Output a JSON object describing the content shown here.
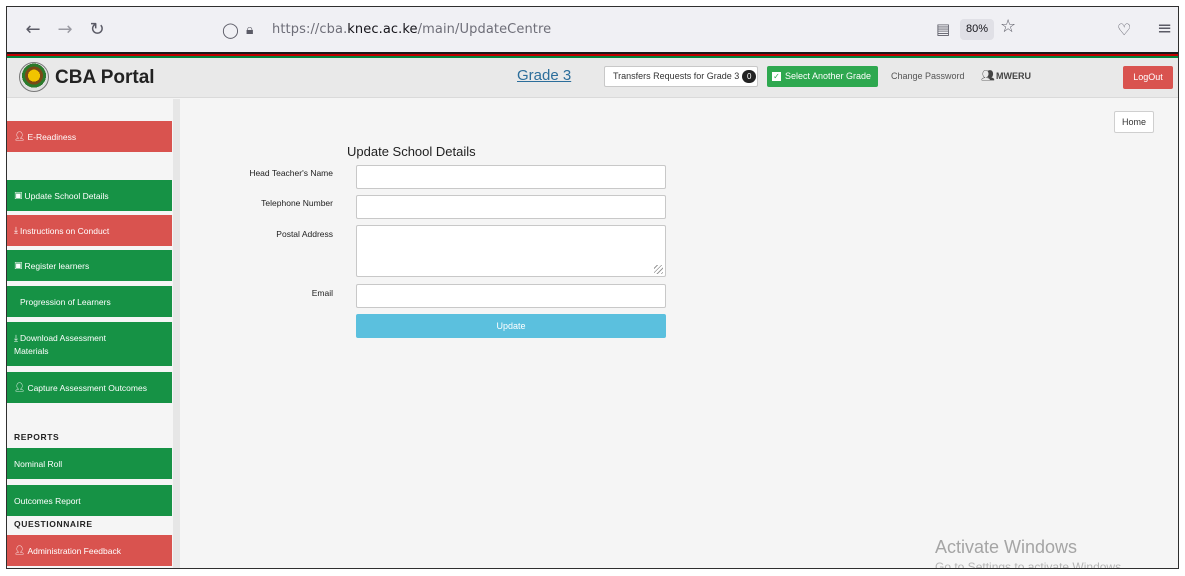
{
  "browser": {
    "nav_back_icon": "arrow-left",
    "nav_forward_icon": "arrow-right",
    "reload_icon": "reload",
    "url_prefix": "https://cba.",
    "url_domain": "knec.ac.ke",
    "url_path": "/main/UpdateCentre",
    "zoom": "80%"
  },
  "header": {
    "brand": "CBA Portal",
    "grade": "Grade 3",
    "transfers_label": "Transfers Requests for Grade 3",
    "transfers_count": "0",
    "select_grade_label": "Select Another Grade",
    "change_password": "Change Password",
    "user_name": "MWERU",
    "logout": "LogOut"
  },
  "sidebar": {
    "items": [
      {
        "label": "E-Readiness",
        "color": "#d9534f"
      },
      {
        "label": "Update School Details",
        "color": "#169245"
      },
      {
        "label": "Instructions on Conduct",
        "color": "#d9534f"
      },
      {
        "label": "Register learners",
        "color": "#169245"
      },
      {
        "label": "Progression of Learners",
        "color": "#169245"
      },
      {
        "label": "Download Assessment Materials",
        "color": "#169245"
      },
      {
        "label": "Capture Assessment Outcomes",
        "color": "#169245"
      },
      {
        "label": "Nominal Roll",
        "color": "#169245"
      },
      {
        "label": "Outcomes Report",
        "color": "#169245"
      },
      {
        "label": "Administration Feedback",
        "color": "#d9534f"
      }
    ],
    "headings": {
      "reports": "REPORTS",
      "questionnaire": "QUESTIONNAIRE"
    }
  },
  "main": {
    "home_label": "Home",
    "form_title": "Update School Details",
    "fields": {
      "head_teacher": {
        "label": "Head Teacher's Name",
        "value": ""
      },
      "telephone": {
        "label": "Telephone Number",
        "value": ""
      },
      "postal": {
        "label": "Postal Address",
        "value": ""
      },
      "email": {
        "label": "Email",
        "value": ""
      }
    },
    "update_label": "Update"
  },
  "watermark": {
    "title": "Activate Windows",
    "subtitle": "Go to Settings to activate Windows."
  }
}
